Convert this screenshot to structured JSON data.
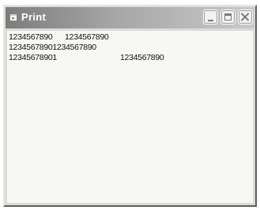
{
  "window": {
    "title": "Print",
    "icon": "form-icon",
    "controls": {
      "minimize": "minimize-icon",
      "maximize": "maximize-icon",
      "close": "close-icon"
    }
  },
  "output": {
    "row1": {
      "col1": "1234567890",
      "col2": "1234567890"
    },
    "row2": {
      "col1": "12345678901234567890"
    },
    "row3": {
      "col1": "12345678901",
      "col2": "1234567890"
    }
  },
  "colors": {
    "titlebar_start": "#7d7d7d",
    "titlebar_end": "#c9c9c9",
    "client_background": "#f7f7f5",
    "text": "#111111"
  }
}
